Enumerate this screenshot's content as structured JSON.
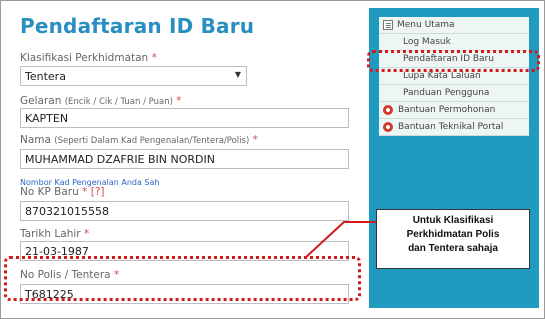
{
  "page": {
    "title": "Pendaftaran ID Baru"
  },
  "form": {
    "klasifikasi": {
      "label": "Klasifikasi Perkhidmatan",
      "required": "*",
      "value": "Tentera"
    },
    "gelaran": {
      "label": "Gelaran",
      "hint": "(Encik / Cik / Tuan / Puan)",
      "required": "*",
      "value": "KAPTEN"
    },
    "nama": {
      "label": "Nama",
      "hint": "(Seperti Dalam Kad Pengenalan/Tentera/Polis)",
      "required": "*",
      "value": "MUHAMMAD DZAFRIE BIN NORDIN"
    },
    "kp": {
      "helper": "Nombor Kad Pengenalan Anda Sah",
      "label": "No KP Baru",
      "required": "*",
      "help_link": "[?]",
      "value": "870321015558"
    },
    "tarikh": {
      "label": "Tarikh Lahir",
      "required": "*",
      "value": "21-03-1987"
    },
    "polis": {
      "label": "No Polis / Tentera",
      "required": "*",
      "value": "T681225"
    }
  },
  "sidebar": {
    "items": [
      {
        "label": "Menu Utama",
        "icon": "document-icon"
      },
      {
        "label": "Log Masuk"
      },
      {
        "label": "Pendaftaran ID Baru"
      },
      {
        "label": "Lupa Kata Laluan"
      },
      {
        "label": "Panduan Pengguna"
      },
      {
        "label": "Bantuan Permohonan",
        "icon": "lifebuoy-icon"
      },
      {
        "label": "Bantuan Teknikal Portal",
        "icon": "lifebuoy-icon"
      }
    ]
  },
  "callout": {
    "lines": [
      "Untuk Klasifikasi",
      "Perkhidmatan Polis",
      "dan Tentera sahaja"
    ]
  },
  "colors": {
    "title": "#2a8fc0",
    "sidebar": "#1f9bbf",
    "required": "#d14b4b",
    "highlight": "#d11a1a"
  }
}
